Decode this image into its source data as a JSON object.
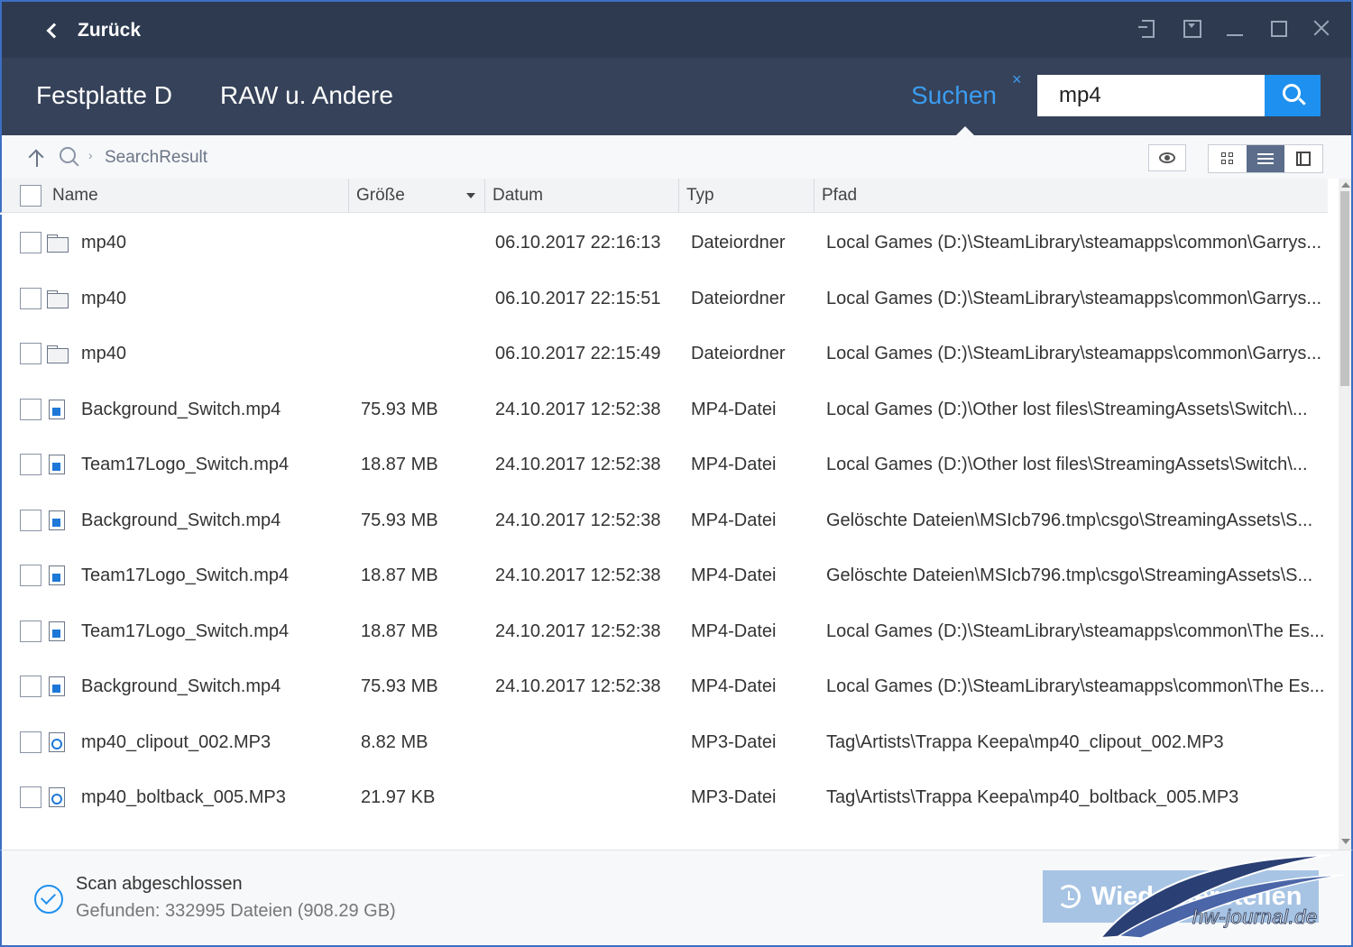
{
  "titlebar": {
    "back_label": "Zurück",
    "controls": [
      "exit-icon",
      "menu-icon",
      "minimize-icon",
      "maximize-icon",
      "close-icon"
    ]
  },
  "header": {
    "crumbs": [
      "Festplatte D",
      "RAW u. Andere"
    ],
    "search_tab_label": "Suchen",
    "search_close": "×",
    "search_value": "mp4"
  },
  "toolbar": {
    "path_separator": "›",
    "path": "SearchResult"
  },
  "table": {
    "columns": {
      "name": "Name",
      "size": "Größe",
      "date": "Datum",
      "type": "Typ",
      "path": "Pfad"
    },
    "rows": [
      {
        "icon": "folder-icon",
        "name": "mp40",
        "size": "",
        "date": "06.10.2017 22:16:13",
        "type": "Dateiordner",
        "path": "Local Games (D:)\\SteamLibrary\\steamapps\\common\\Garrys..."
      },
      {
        "icon": "folder-icon",
        "name": "mp40",
        "size": "",
        "date": "06.10.2017 22:15:51",
        "type": "Dateiordner",
        "path": "Local Games (D:)\\SteamLibrary\\steamapps\\common\\Garrys..."
      },
      {
        "icon": "folder-icon",
        "name": "mp40",
        "size": "",
        "date": "06.10.2017 22:15:49",
        "type": "Dateiordner",
        "path": "Local Games (D:)\\SteamLibrary\\steamapps\\common\\Garrys..."
      },
      {
        "icon": "video-file-icon",
        "name": "Background_Switch.mp4",
        "size": "75.93 MB",
        "date": "24.10.2017 12:52:38",
        "type": "MP4-Datei",
        "path": "Local Games (D:)\\Other lost files\\StreamingAssets\\Switch\\..."
      },
      {
        "icon": "video-file-icon",
        "name": "Team17Logo_Switch.mp4",
        "size": "18.87 MB",
        "date": "24.10.2017 12:52:38",
        "type": "MP4-Datei",
        "path": "Local Games (D:)\\Other lost files\\StreamingAssets\\Switch\\..."
      },
      {
        "icon": "video-file-icon",
        "name": "Background_Switch.mp4",
        "size": "75.93 MB",
        "date": "24.10.2017 12:52:38",
        "type": "MP4-Datei",
        "path": "Gelöschte Dateien\\MSIcb796.tmp\\csgo\\StreamingAssets\\S..."
      },
      {
        "icon": "video-file-icon",
        "name": "Team17Logo_Switch.mp4",
        "size": "18.87 MB",
        "date": "24.10.2017 12:52:38",
        "type": "MP4-Datei",
        "path": "Gelöschte Dateien\\MSIcb796.tmp\\csgo\\StreamingAssets\\S..."
      },
      {
        "icon": "video-file-icon",
        "name": "Team17Logo_Switch.mp4",
        "size": "18.87 MB",
        "date": "24.10.2017 12:52:38",
        "type": "MP4-Datei",
        "path": "Local Games (D:)\\SteamLibrary\\steamapps\\common\\The Es..."
      },
      {
        "icon": "video-file-icon",
        "name": "Background_Switch.mp4",
        "size": "75.93 MB",
        "date": "24.10.2017 12:52:38",
        "type": "MP4-Datei",
        "path": "Local Games (D:)\\SteamLibrary\\steamapps\\common\\The Es..."
      },
      {
        "icon": "audio-file-icon",
        "name": "mp40_clipout_002.MP3",
        "size": "8.82 MB",
        "date": "",
        "type": "MP3-Datei",
        "path": "Tag\\Artists\\Trappa Keepa\\mp40_clipout_002.MP3"
      },
      {
        "icon": "audio-file-icon",
        "name": "mp40_boltback_005.MP3",
        "size": "21.97 KB",
        "date": "",
        "type": "MP3-Datei",
        "path": "Tag\\Artists\\Trappa Keepa\\mp40_boltback_005.MP3"
      }
    ]
  },
  "footer": {
    "status_title": "Scan abgeschlossen",
    "status_detail": "Gefunden: 332995 Dateien (908.29 GB)",
    "restore_label": "Wiederherstellen"
  },
  "watermark": {
    "text": "hw-journal.de"
  },
  "colors": {
    "titlebar": "#2d3a50",
    "header": "#364259",
    "accent": "#1e90ef",
    "restore_button": "#a7c4e4"
  }
}
